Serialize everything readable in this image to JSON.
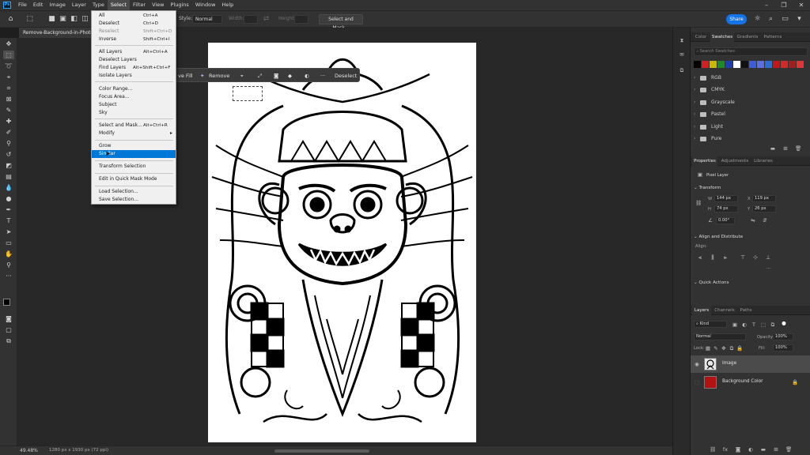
{
  "app": {
    "logo": "Ps",
    "menus": [
      "File",
      "Edit",
      "Image",
      "Layer",
      "Type",
      "Select",
      "Filter",
      "View",
      "Plugins",
      "Window",
      "Help"
    ],
    "active_menu": "Select"
  },
  "options_bar": {
    "style_label": "Style:",
    "style_value": "Normal",
    "width_label": "Width:",
    "height_label": "Height:",
    "select_and_mask": "Select and Mask...",
    "share": "Share"
  },
  "document": {
    "tab_title": "Remove-Background-in-Photoshop",
    "zoom": "49.48%",
    "info": "1280 px x 1930 px (72 ppi)"
  },
  "context_bar": {
    "fill_label": "ve Fill",
    "remove_label": "Remove",
    "more_label": "···",
    "deselect_label": "Deselect"
  },
  "select_menu": {
    "items": [
      {
        "label": "All",
        "shortcut": "Ctrl+A"
      },
      {
        "label": "Deselect",
        "shortcut": "Ctrl+D"
      },
      {
        "label": "Reselect",
        "shortcut": "Shift+Ctrl+D"
      },
      {
        "label": "Inverse",
        "shortcut": "Shift+Ctrl+I"
      },
      {
        "label": "All Layers",
        "shortcut": "Alt+Ctrl+A"
      },
      {
        "label": "Deselect Layers",
        "shortcut": ""
      },
      {
        "label": "Find Layers",
        "shortcut": "Alt+Shift+Ctrl+F"
      },
      {
        "label": "Isolate Layers",
        "shortcut": ""
      },
      {
        "label": "Color Range...",
        "shortcut": ""
      },
      {
        "label": "Focus Area...",
        "shortcut": ""
      },
      {
        "label": "Subject",
        "shortcut": ""
      },
      {
        "label": "Sky",
        "shortcut": ""
      },
      {
        "label": "Select and Mask...",
        "shortcut": "Alt+Ctrl+R"
      },
      {
        "label": "Modify",
        "shortcut": ""
      },
      {
        "label": "Grow",
        "shortcut": ""
      },
      {
        "label": "Similar",
        "shortcut": ""
      },
      {
        "label": "Transform Selection",
        "shortcut": ""
      },
      {
        "label": "Edit in Quick Mask Mode",
        "shortcut": ""
      },
      {
        "label": "Load Selection...",
        "shortcut": ""
      },
      {
        "label": "Save Selection...",
        "shortcut": ""
      }
    ],
    "highlighted": "Similar",
    "disabled": [
      "Reselect"
    ]
  },
  "swatches_panel": {
    "tabs": [
      "Color",
      "Swatches",
      "Gradients",
      "Patterns"
    ],
    "active_tab": "Swatches",
    "search_placeholder": "Search Swatches",
    "colors": [
      "#000000",
      "#d31f1f",
      "#c9b800",
      "#1d8a2a",
      "#1f3fb0",
      "#ffffff",
      "#111111",
      "#3c5cd8",
      "#5a6fe0",
      "#2a6fd0",
      "#c01818",
      "#d02a2a",
      "#a02020",
      "#e03535"
    ],
    "folders": [
      "RGB",
      "CMYK",
      "Grayscale",
      "Pastel",
      "Light",
      "Pure"
    ]
  },
  "properties_panel": {
    "tabs": [
      "Properties",
      "Adjustments",
      "Libraries"
    ],
    "active_tab": "Properties",
    "layer_kind": "Pixel Layer",
    "transform_title": "Transform",
    "w_label": "W",
    "w": "144 px",
    "x_label": "X",
    "x": "119 px",
    "h_label": "H",
    "h": "74 px",
    "y_label": "Y",
    "y": "26 px",
    "angle": "0.00°",
    "align_title": "Align and Distribute",
    "align_label": "Align:",
    "more": "···",
    "quick_actions_title": "Quick Actions"
  },
  "layers_panel": {
    "tabs": [
      "Layers",
      "Channels",
      "Paths"
    ],
    "active_tab": "Layers",
    "kind": "Kind",
    "blend_mode": "Normal",
    "opacity_label": "Opacity:",
    "opacity": "100%",
    "lock_label": "Lock:",
    "fill_label": "Fill:",
    "fill": "100%",
    "layers": [
      {
        "name": "Image",
        "selected": true,
        "visible": true,
        "thumb_color": "#e8e8e8"
      },
      {
        "name": "Background Color",
        "selected": false,
        "visible": false,
        "thumb_color": "#b31212"
      }
    ]
  }
}
